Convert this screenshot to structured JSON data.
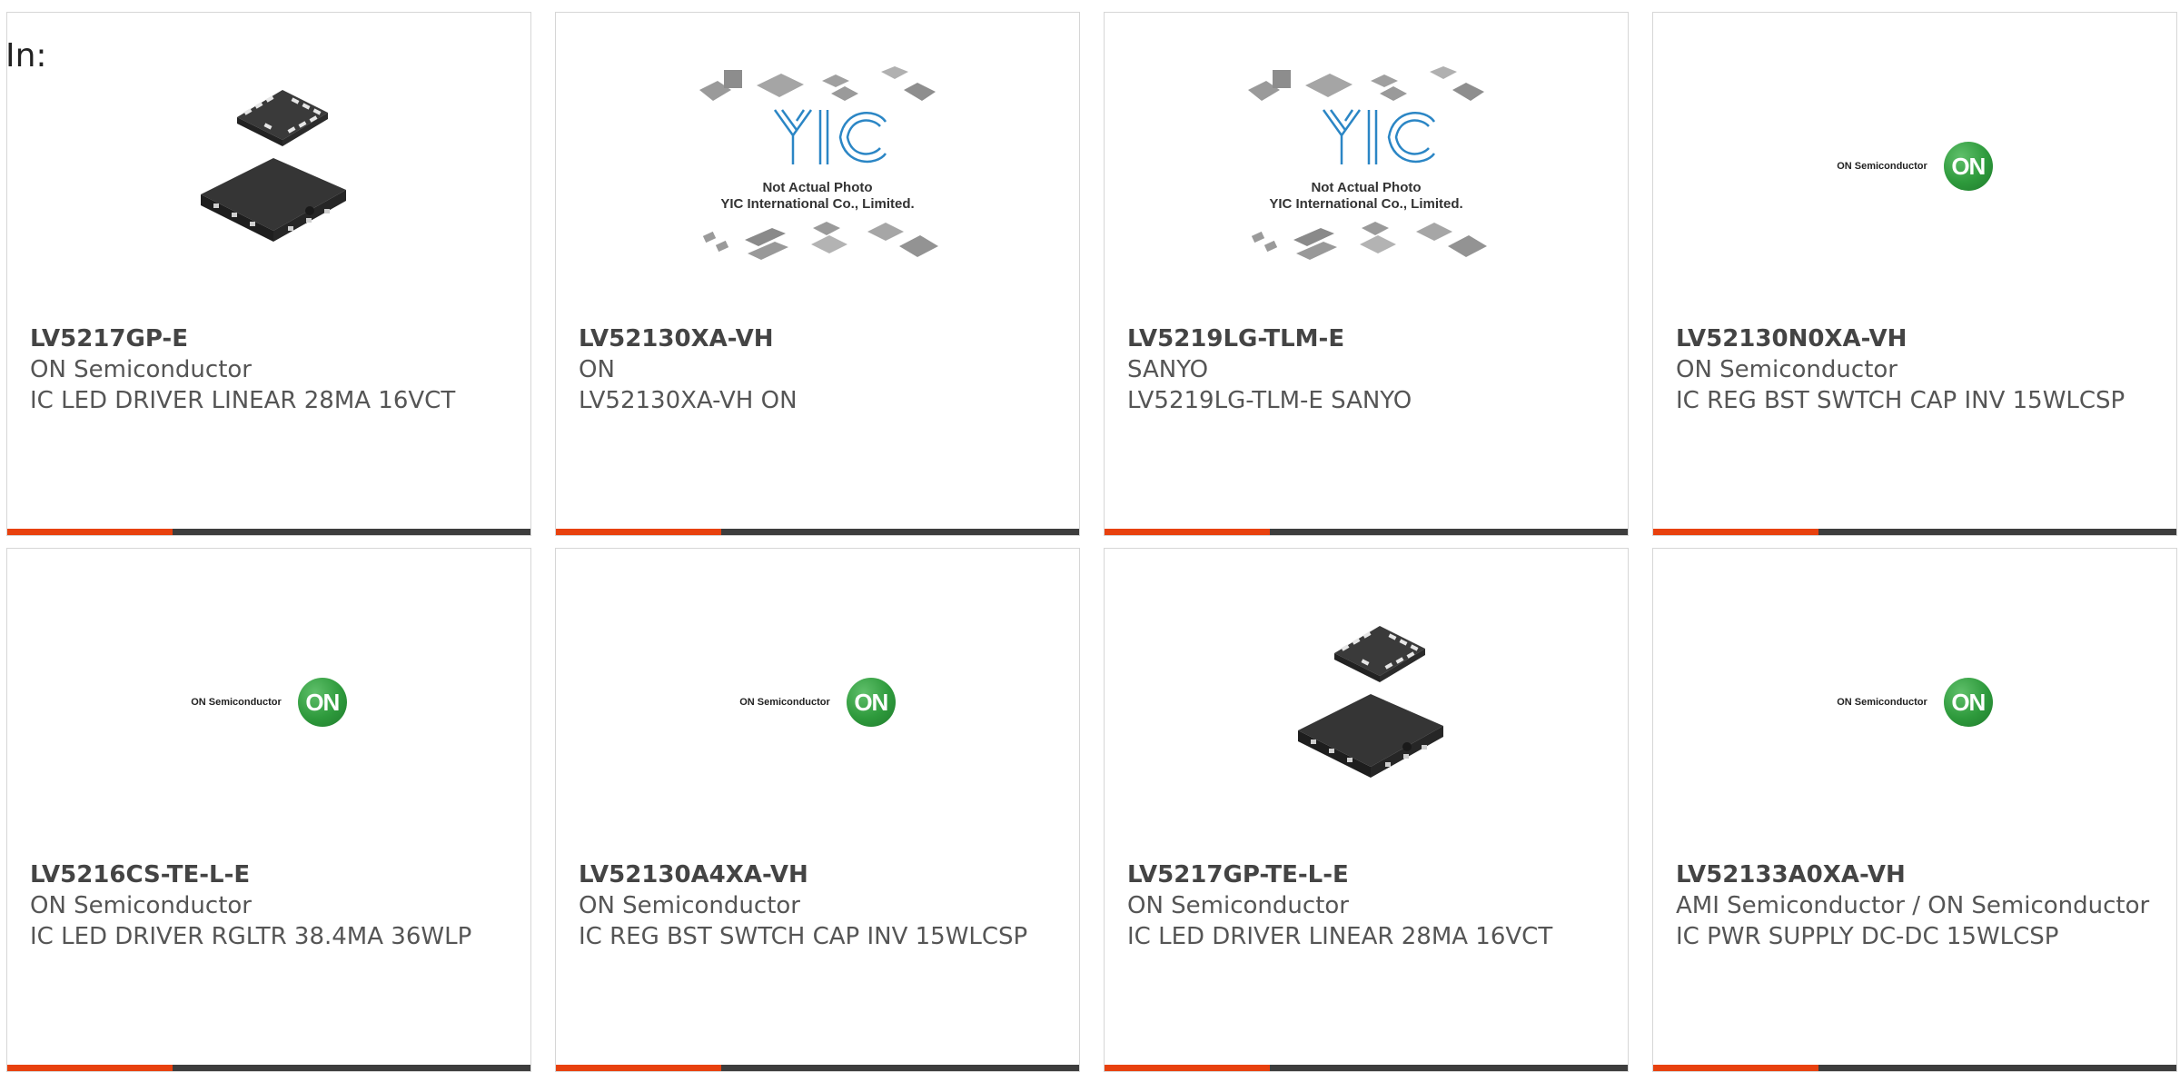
{
  "page": {
    "label": "In:"
  },
  "logos": {
    "on_text": "ON Semiconductor",
    "on_mark": "ON",
    "yic_mark": "YIC",
    "yic_caption_1": "Not Actual Photo",
    "yic_caption_2": "YIC International Co., Limited."
  },
  "colors": {
    "accent": "#e8410e",
    "bar": "#3d3d3d",
    "on_green": "#2e9a3c",
    "yic_blue": "#2b86c5"
  },
  "products": [
    {
      "part": "LV5217GP-E",
      "manufacturer": "ON Semiconductor",
      "description": "IC LED DRIVER LINEAR 28MA 16VCT",
      "image": "qfn-chip-photo"
    },
    {
      "part": "LV52130XA-VH",
      "manufacturer": "ON",
      "description": "LV52130XA-VH ON",
      "image": "yic-placeholder"
    },
    {
      "part": "LV5219LG-TLM-E",
      "manufacturer": "SANYO",
      "description": "LV5219LG-TLM-E SANYO",
      "image": "yic-placeholder"
    },
    {
      "part": "LV52130N0XA-VH",
      "manufacturer": "ON Semiconductor",
      "description": "IC REG BST SWTCH CAP INV 15WLCSP",
      "image": "on-semiconductor-logo"
    },
    {
      "part": "LV5216CS-TE-L-E",
      "manufacturer": "ON Semiconductor",
      "description": "IC LED DRIVER RGLTR 38.4MA 36WLP",
      "image": "on-semiconductor-logo"
    },
    {
      "part": "LV52130A4XA-VH",
      "manufacturer": "ON Semiconductor",
      "description": "IC REG BST SWTCH CAP INV 15WLCSP",
      "image": "on-semiconductor-logo"
    },
    {
      "part": "LV5217GP-TE-L-E",
      "manufacturer": "ON Semiconductor",
      "description": "IC LED DRIVER LINEAR 28MA 16VCT",
      "image": "qfn-chip-photo"
    },
    {
      "part": "LV52133A0XA-VH",
      "manufacturer": "AMI Semiconductor / ON Semiconductor",
      "description": "IC PWR SUPPLY DC-DC 15WLCSP",
      "image": "on-semiconductor-logo"
    }
  ]
}
